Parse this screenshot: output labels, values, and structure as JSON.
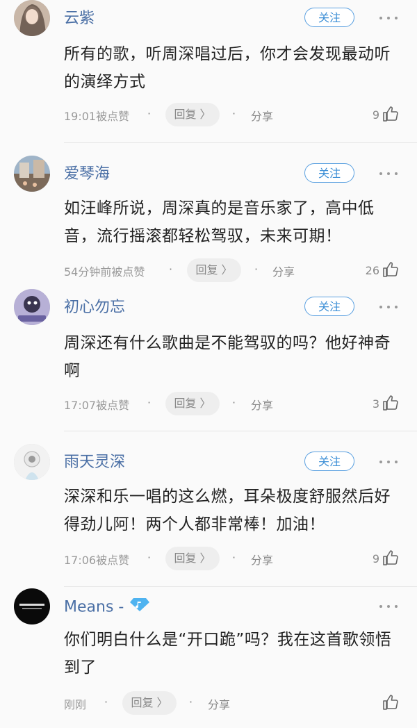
{
  "comments": [
    {
      "username": "云紫",
      "follow_label": "关注",
      "text": "所有的歌，听周深唱过后，你才会发现最动听的演绎方式",
      "time": "19:01被点赞",
      "reply_label": "回复 〉",
      "share_label": "分享",
      "likes": "9"
    },
    {
      "username": "爱琴海",
      "follow_label": "关注",
      "text": "如汪峰所说，周深真的是音乐家了，高中低音，流行摇滚都轻松驾驭，未来可期！",
      "time": "54分钟前被点赞",
      "reply_label": "回复 〉",
      "share_label": "分享",
      "likes": "26"
    },
    {
      "username": "初心勿忘",
      "follow_label": "关注",
      "text": "周深还有什么歌曲是不能驾驭的吗？他好神奇啊",
      "time": "17:07被点赞",
      "reply_label": "回复 〉",
      "share_label": "分享",
      "likes": "3"
    },
    {
      "username": "雨天灵深",
      "follow_label": "关注",
      "text": "深深和乐一唱的这么燃，耳朵极度舒服然后好得劲儿阿！两个人都非常棒！加油！",
      "time": "17:06被点赞",
      "reply_label": "回复 〉",
      "share_label": "分享",
      "likes": "9"
    },
    {
      "username": "Means -",
      "text": "你们明白什么是“开口跪”吗？我在这首歌领悟到了",
      "time": "刚刚",
      "reply_label": "回复 〉",
      "share_label": "分享",
      "likes": ""
    }
  ],
  "colors": {
    "username": "#4a6fa5",
    "follow": "#3d8fd6",
    "diamond": "#4fb3f0"
  }
}
